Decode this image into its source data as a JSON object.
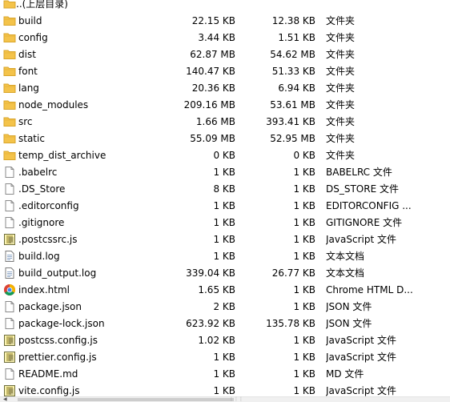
{
  "parent": {
    "label": "..(上层目录)"
  },
  "rows": [
    {
      "name": "build",
      "size": "22.15 KB",
      "packed": "12.38 KB",
      "type": "文件夹",
      "icon": "folder-icon"
    },
    {
      "name": "config",
      "size": "3.44 KB",
      "packed": "1.51 KB",
      "type": "文件夹",
      "icon": "folder-icon"
    },
    {
      "name": "dist",
      "size": "62.87 MB",
      "packed": "54.62 MB",
      "type": "文件夹",
      "icon": "folder-icon"
    },
    {
      "name": "font",
      "size": "140.47 KB",
      "packed": "51.33 KB",
      "type": "文件夹",
      "icon": "folder-icon"
    },
    {
      "name": "lang",
      "size": "20.36 KB",
      "packed": "6.94 KB",
      "type": "文件夹",
      "icon": "folder-icon"
    },
    {
      "name": "node_modules",
      "size": "209.16 MB",
      "packed": "53.61 MB",
      "type": "文件夹",
      "icon": "folder-icon"
    },
    {
      "name": "src",
      "size": "1.66 MB",
      "packed": "393.41 KB",
      "type": "文件夹",
      "icon": "folder-icon"
    },
    {
      "name": "static",
      "size": "55.09 MB",
      "packed": "52.95 MB",
      "type": "文件夹",
      "icon": "folder-icon"
    },
    {
      "name": "temp_dist_archive",
      "size": "0 KB",
      "packed": "0 KB",
      "type": "文件夹",
      "icon": "folder-icon"
    },
    {
      "name": ".babelrc",
      "size": "1 KB",
      "packed": "1 KB",
      "type": "BABELRC 文件",
      "icon": "file-icon"
    },
    {
      "name": ".DS_Store",
      "size": "8 KB",
      "packed": "1 KB",
      "type": "DS_STORE 文件",
      "icon": "file-icon"
    },
    {
      "name": ".editorconfig",
      "size": "1 KB",
      "packed": "1 KB",
      "type": "EDITORCONFIG ...",
      "icon": "file-icon"
    },
    {
      "name": ".gitignore",
      "size": "1 KB",
      "packed": "1 KB",
      "type": "GITIGNORE 文件",
      "icon": "file-icon"
    },
    {
      "name": ".postcssrc.js",
      "size": "1 KB",
      "packed": "1 KB",
      "type": "JavaScript 文件",
      "icon": "js-script-icon"
    },
    {
      "name": "build.log",
      "size": "1 KB",
      "packed": "1 KB",
      "type": "文本文档",
      "icon": "text-document-icon"
    },
    {
      "name": "build_output.log",
      "size": "339.04 KB",
      "packed": "26.77 KB",
      "type": "文本文档",
      "icon": "text-document-icon"
    },
    {
      "name": "index.html",
      "size": "1.65 KB",
      "packed": "1 KB",
      "type": "Chrome HTML D...",
      "icon": "chrome-icon"
    },
    {
      "name": "package.json",
      "size": "2 KB",
      "packed": "1 KB",
      "type": "JSON 文件",
      "icon": "file-icon"
    },
    {
      "name": "package-lock.json",
      "size": "623.92 KB",
      "packed": "135.78 KB",
      "type": "JSON 文件",
      "icon": "file-icon"
    },
    {
      "name": "postcss.config.js",
      "size": "1.02 KB",
      "packed": "1 KB",
      "type": "JavaScript 文件",
      "icon": "js-script-icon"
    },
    {
      "name": "prettier.config.js",
      "size": "1 KB",
      "packed": "1 KB",
      "type": "JavaScript 文件",
      "icon": "js-script-icon"
    },
    {
      "name": "README.md",
      "size": "1 KB",
      "packed": "1 KB",
      "type": "MD 文件",
      "icon": "file-icon"
    },
    {
      "name": "vite.config.js",
      "size": "1 KB",
      "packed": "1 KB",
      "type": "JavaScript 文件",
      "icon": "js-script-icon"
    }
  ],
  "colors": {
    "folder": "#f4c34a",
    "folder_dark": "#d9a52b",
    "selection": "#cce8ff"
  }
}
